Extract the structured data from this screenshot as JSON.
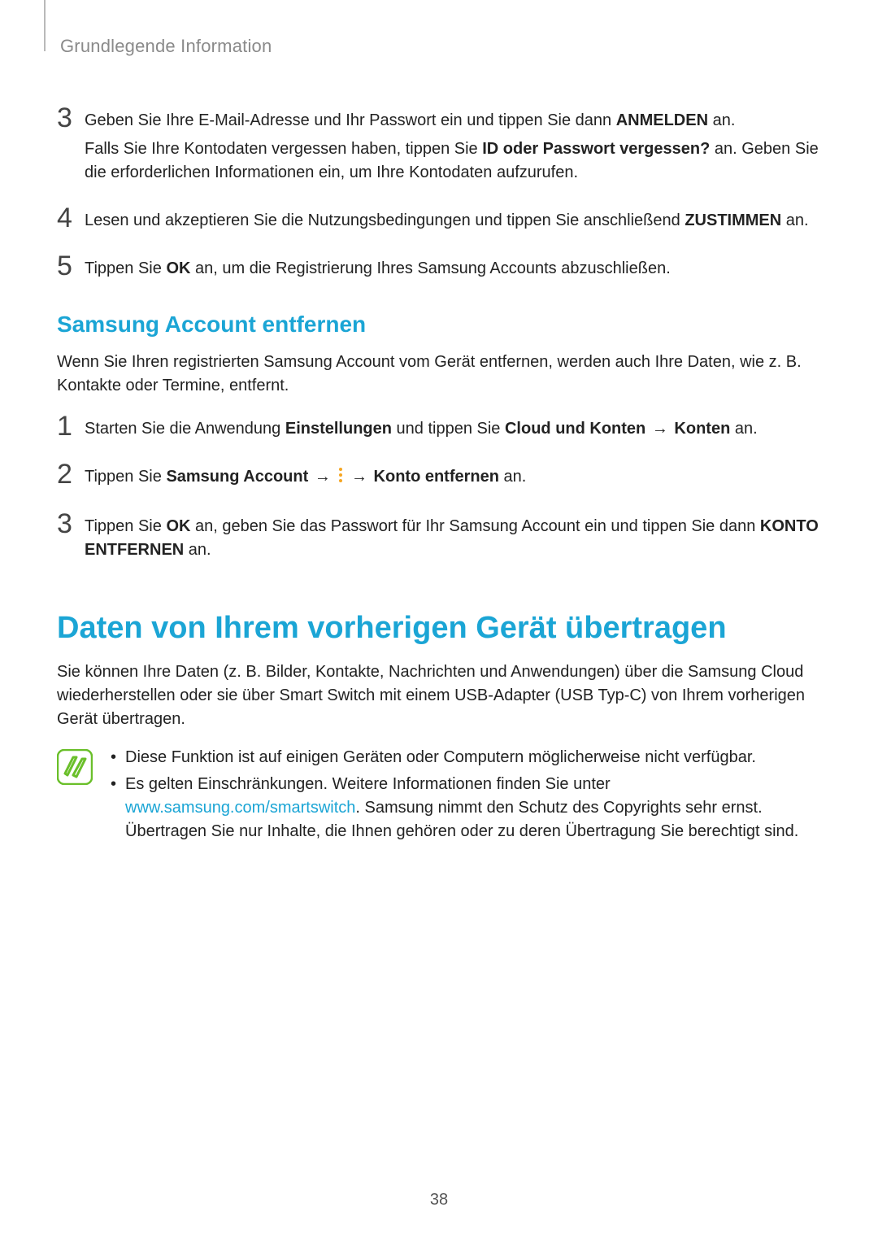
{
  "header": {
    "section": "Grundlegende Information"
  },
  "steps_a": [
    {
      "num": "3",
      "p1_a": "Geben Sie Ihre E-Mail-Adresse und Ihr Passwort ein und tippen Sie dann ",
      "p1_b": "ANMELDEN",
      "p1_c": " an.",
      "p2_a": "Falls Sie Ihre Kontodaten vergessen haben, tippen Sie ",
      "p2_b": "ID oder Passwort vergessen?",
      "p2_c": " an. Geben Sie die erforderlichen Informationen ein, um Ihre Kontodaten aufzurufen."
    },
    {
      "num": "4",
      "p1_a": "Lesen und akzeptieren Sie die Nutzungsbedingungen und tippen Sie anschließend ",
      "p1_b": "ZUSTIMMEN",
      "p1_c": " an."
    },
    {
      "num": "5",
      "p1_a": "Tippen Sie ",
      "p1_b": "OK",
      "p1_c": " an, um die Registrierung Ihres Samsung Accounts abzuschließen."
    }
  ],
  "subheading_remove": "Samsung Account entfernen",
  "remove_intro": "Wenn Sie Ihren registrierten Samsung Account vom Gerät entfernen, werden auch Ihre Daten, wie z. B. Kontakte oder Termine, entfernt.",
  "steps_b": [
    {
      "num": "1",
      "t1": "Starten Sie die Anwendung ",
      "b1": "Einstellungen",
      "t2": " und tippen Sie ",
      "b2": "Cloud und Konten",
      "arrow1": " → ",
      "b3": "Konten",
      "t3": " an."
    },
    {
      "num": "2",
      "t1": "Tippen Sie ",
      "b1": "Samsung Account",
      "arrow1": " → ",
      "arrow2": " → ",
      "b2": "Konto entfernen",
      "t2": " an."
    },
    {
      "num": "3",
      "t1": "Tippen Sie ",
      "b1": "OK",
      "t2": " an, geben Sie das Passwort für Ihr Samsung Account ein und tippen Sie dann ",
      "b2": "KONTO ENTFERNEN",
      "t3": " an."
    }
  ],
  "main_heading": "Daten von Ihrem vorherigen Gerät übertragen",
  "main_intro": "Sie können Ihre Daten (z. B. Bilder, Kontakte, Nachrichten und Anwendungen) über die Samsung Cloud wiederherstellen oder sie über Smart Switch mit einem USB-Adapter (USB Typ-C) von Ihrem vorherigen Gerät übertragen.",
  "note": {
    "bullet1": "Diese Funktion ist auf einigen Geräten oder Computern möglicherweise nicht verfügbar.",
    "bullet2_a": "Es gelten Einschränkungen. Weitere Informationen finden Sie unter ",
    "bullet2_link": "www.samsung.com/smartswitch",
    "bullet2_b": ". Samsung nimmt den Schutz des Copyrights sehr ernst. Übertragen Sie nur Inhalte, die Ihnen gehören oder zu deren Übertragung Sie berechtigt sind."
  },
  "page_number": "38"
}
